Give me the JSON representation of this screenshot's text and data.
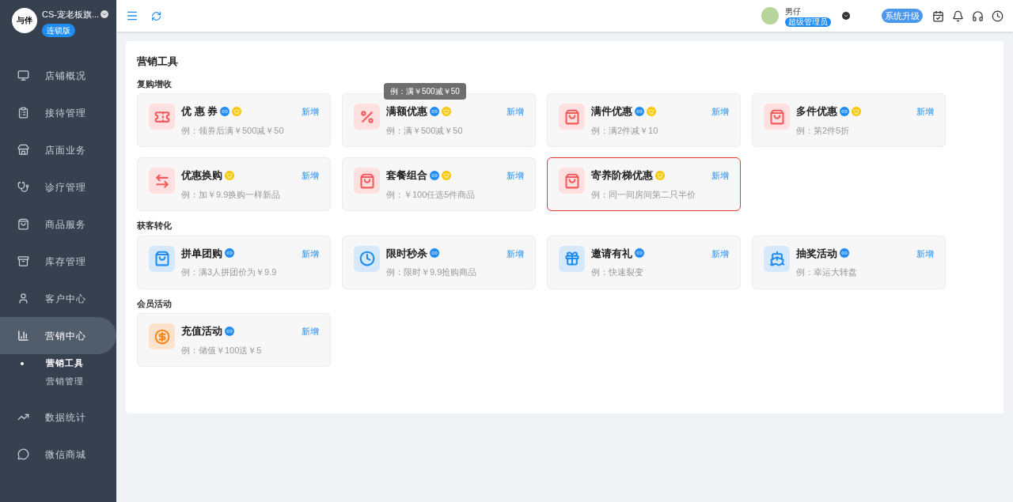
{
  "store": {
    "name": "CS-宠老板旗...",
    "badge": "连锁版",
    "logo_text": "与伴"
  },
  "user": {
    "name": "男仔",
    "role": "超级管理员"
  },
  "upgrade_button": "系统升级",
  "sidebar": {
    "items": [
      {
        "label": "店铺概况",
        "selected": false
      },
      {
        "label": "接待管理",
        "selected": false
      },
      {
        "label": "店面业务",
        "selected": false
      },
      {
        "label": "诊疗管理",
        "selected": false
      },
      {
        "label": "商品服务",
        "selected": false
      },
      {
        "label": "库存管理",
        "selected": false
      },
      {
        "label": "客户中心",
        "selected": false
      },
      {
        "label": "营销中心",
        "selected": true,
        "children": [
          {
            "label": "营销工具",
            "selected": true
          },
          {
            "label": "营销管理",
            "selected": false
          }
        ]
      },
      {
        "label": "数据统计",
        "selected": false
      },
      {
        "label": "微信商城",
        "selected": false
      }
    ]
  },
  "page_title": "营销工具",
  "sections": [
    {
      "title": "复购增收",
      "cards": [
        {
          "title": "优 惠 券",
          "example": "例：领券后满￥500减￥50",
          "color": "#f25b5b",
          "link": true,
          "crown": true,
          "action": "新增",
          "selected": false
        },
        {
          "title": "满额优惠",
          "example": "例：满￥500减￥50",
          "color": "#f25b5b",
          "link": true,
          "crown": true,
          "action": "新增",
          "selected": false,
          "tooltip": "例：满￥500减￥50"
        },
        {
          "title": "满件优惠",
          "example": "例：满2件减￥10",
          "color": "#f25b5b",
          "link": true,
          "crown": true,
          "action": "新增",
          "selected": false
        },
        {
          "title": "多件优惠",
          "example": "例：第2件5折",
          "color": "#f25b5b",
          "link": true,
          "crown": true,
          "action": "新增",
          "selected": false
        },
        {
          "title": "优惠换购",
          "example": "例：加￥9.9换购一样新品",
          "color": "#f25b5b",
          "link": false,
          "crown": true,
          "action": "新增",
          "selected": false
        },
        {
          "title": "套餐组合",
          "example": "例：￥100任选5件商品",
          "color": "#f25b5b",
          "link": true,
          "crown": true,
          "action": "新增",
          "selected": false
        },
        {
          "title": "寄养阶梯优惠",
          "example": "例：同一间房间第二只半价",
          "color": "#f25b5b",
          "link": false,
          "crown": true,
          "action": "新增",
          "selected": true
        }
      ]
    },
    {
      "title": "获客转化",
      "cards": [
        {
          "title": "拼单团购",
          "example": "例：满3人拼团价为￥9.9",
          "color": "#1e8cf0",
          "link": true,
          "crown": false,
          "action": "新增",
          "selected": false
        },
        {
          "title": "限时秒杀",
          "example": "例：限时￥9.9抢购商品",
          "color": "#1e8cf0",
          "link": true,
          "crown": false,
          "action": "新增",
          "selected": false
        },
        {
          "title": "邀请有礼",
          "example": "例：快速裂变",
          "color": "#1e8cf0",
          "link": true,
          "crown": false,
          "action": "新增",
          "selected": false
        },
        {
          "title": "抽奖活动",
          "example": "例：幸运大转盘",
          "color": "#1e8cf0",
          "link": true,
          "crown": false,
          "action": "新增",
          "selected": false
        }
      ]
    },
    {
      "title": "会员活动",
      "cards": [
        {
          "title": "充值活动",
          "example": "例：储值￥100送￥5",
          "color": "#f7861e",
          "link": true,
          "crown": false,
          "action": "新增",
          "selected": false
        }
      ]
    }
  ]
}
